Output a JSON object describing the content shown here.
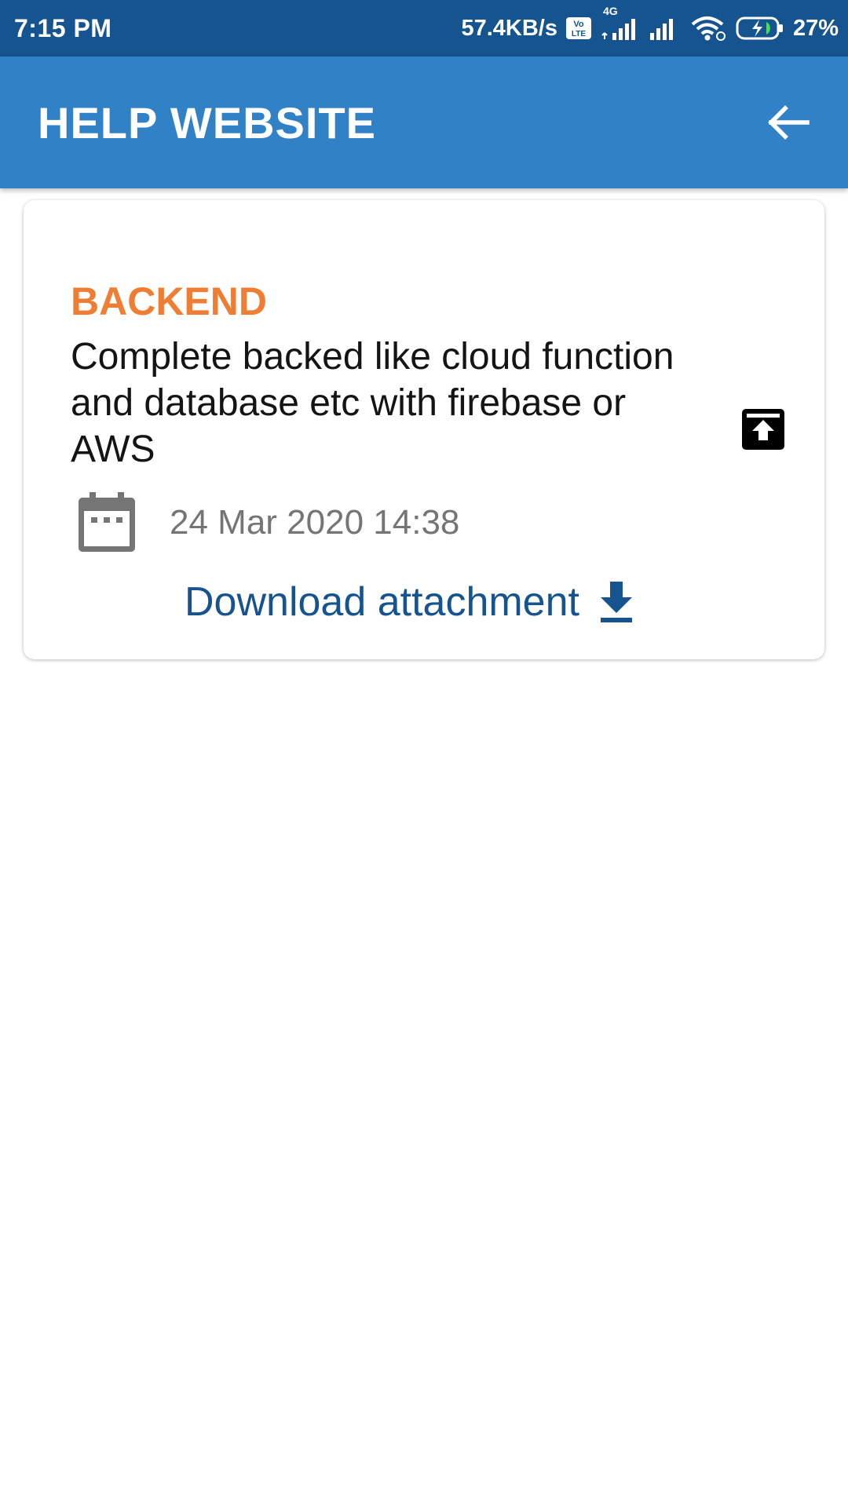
{
  "status_bar": {
    "time": "7:15 PM",
    "network_speed": "57.4KB/s",
    "volte_icon": "volte-icon",
    "network_type": "4G",
    "battery_percent": "27%"
  },
  "app_bar": {
    "title": "HELP WEBSITE",
    "back_icon": "arrow-left-icon"
  },
  "card": {
    "category": "BACKEND",
    "category_color": "#ef7d33",
    "description": "Complete backed like cloud function and database etc with firebase or AWS",
    "date": "24 Mar 2020 14:38",
    "date_icon": "calendar-icon",
    "archive_icon": "archive-icon",
    "download_label": "Download attachment",
    "download_icon": "download-icon",
    "link_color": "#15548e"
  },
  "colors": {
    "status_bar": "#15548e",
    "app_bar": "#3081c5"
  }
}
